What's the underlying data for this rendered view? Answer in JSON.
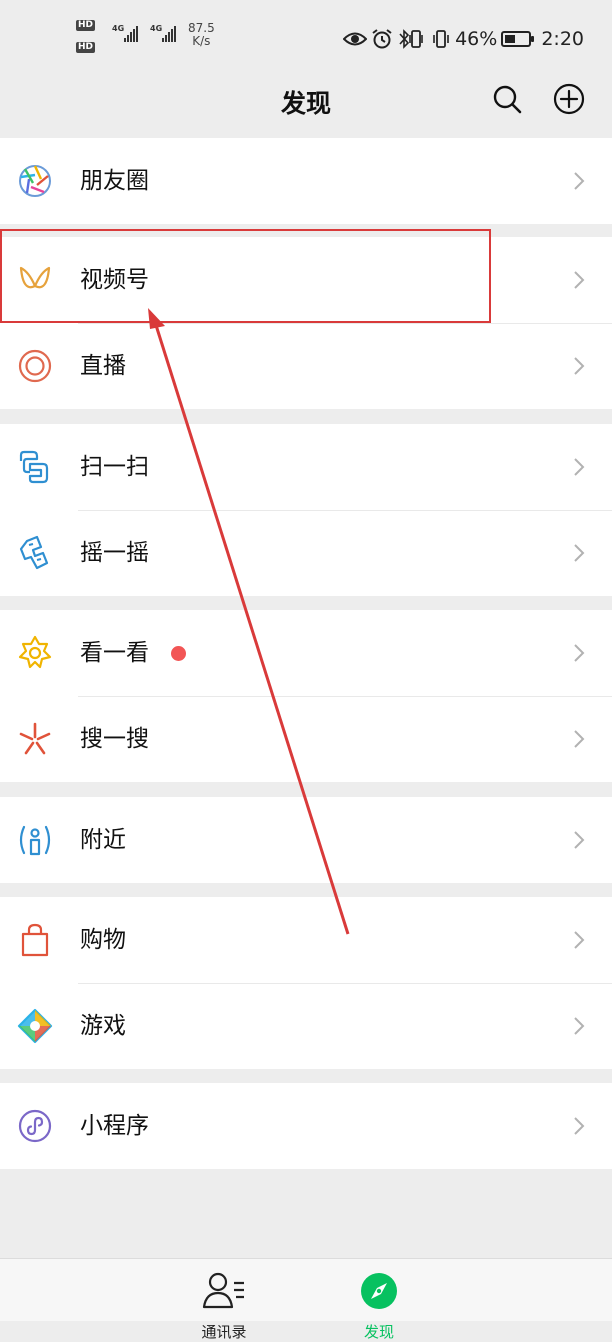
{
  "status_bar": {
    "hd1": "HD",
    "hd2": "HD",
    "sim1_net": "4G",
    "sim2_net": "4G",
    "speed_value": "87.5",
    "speed_unit": "K/s",
    "battery_percent": "46%",
    "battery_level": 0.46,
    "time": "2:20"
  },
  "header": {
    "title": "发现",
    "search_icon": "search-icon",
    "add_icon": "plus-circle-icon"
  },
  "groups": [
    {
      "items": [
        {
          "label": "朋友圈",
          "icon": "moments-aperture-icon"
        }
      ]
    },
    {
      "items": [
        {
          "label": "视频号",
          "icon": "channels-butterfly-icon"
        },
        {
          "label": "直播",
          "icon": "live-ring-icon"
        }
      ]
    },
    {
      "items": [
        {
          "label": "扫一扫",
          "icon": "scan-icon"
        },
        {
          "label": "摇一摇",
          "icon": "shake-phone-icon"
        }
      ]
    },
    {
      "items": [
        {
          "label": "看一看",
          "icon": "top-stories-icon",
          "badge": "red-dot"
        },
        {
          "label": "搜一搜",
          "icon": "search-spark-icon"
        }
      ]
    },
    {
      "items": [
        {
          "label": "附近",
          "icon": "nearby-person-icon"
        }
      ]
    },
    {
      "items": [
        {
          "label": "购物",
          "icon": "shopping-bag-icon"
        },
        {
          "label": "游戏",
          "icon": "game-diamond-icon"
        }
      ]
    },
    {
      "items": [
        {
          "label": "小程序",
          "icon": "mini-program-icon"
        }
      ]
    }
  ],
  "tab_bar": {
    "tabs": [
      {
        "label": "通讯录",
        "icon": "contacts-icon",
        "active": false
      },
      {
        "label": "发现",
        "icon": "discover-compass-icon",
        "active": true
      }
    ]
  },
  "colors": {
    "accent": "#07c160",
    "annotation_red": "#d93a3a",
    "badge_red": "#f25555",
    "background": "#ededed"
  }
}
